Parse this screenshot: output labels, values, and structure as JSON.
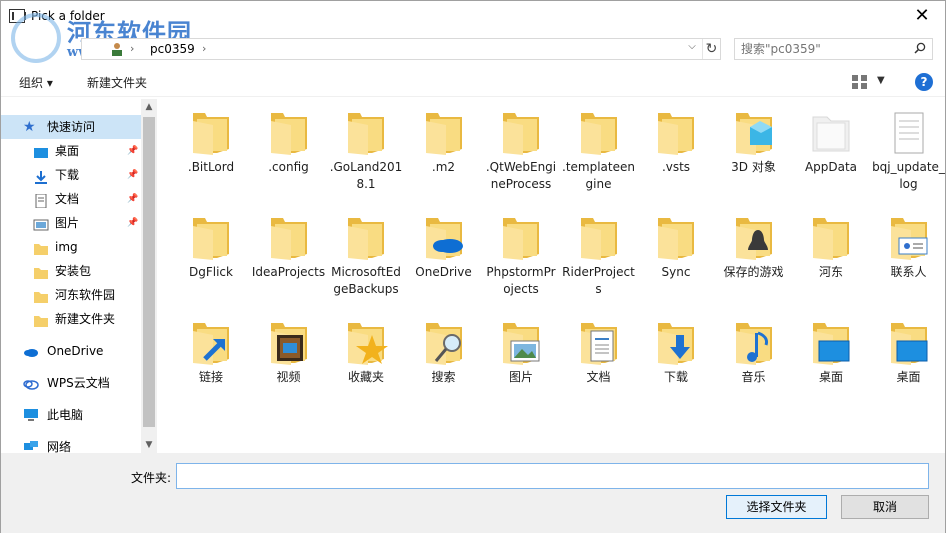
{
  "window": {
    "title": "Pick a folder",
    "close_label": "✕"
  },
  "watermark": {
    "name": "河东软件园",
    "url": "www.pc0359.cn"
  },
  "address": {
    "path": [
      "pc0359"
    ],
    "search_placeholder": "搜索\"pc0359\""
  },
  "toolbar": {
    "organize": "组织 ▾",
    "new_folder": "新建文件夹",
    "help": "?"
  },
  "sidebar": {
    "quick_access": "快速访问",
    "items": [
      {
        "label": "桌面",
        "pinned": true
      },
      {
        "label": "下载",
        "pinned": true
      },
      {
        "label": "文档",
        "pinned": true
      },
      {
        "label": "图片",
        "pinned": true
      },
      {
        "label": "img",
        "pinned": false
      },
      {
        "label": "安装包",
        "pinned": false
      },
      {
        "label": "河东软件园",
        "pinned": false
      },
      {
        "label": "新建文件夹",
        "pinned": false
      }
    ],
    "onedrive": "OneDrive",
    "wps": "WPS云文档",
    "this_pc": "此电脑",
    "network": "网络"
  },
  "folders": [
    {
      "name": ".BitLord",
      "icon": "folder-icon"
    },
    {
      "name": ".config",
      "icon": "folder-icon"
    },
    {
      "name": ".GoLand2018.1",
      "icon": "folder-icon"
    },
    {
      "name": ".m2",
      "icon": "folder-icon"
    },
    {
      "name": ".QtWebEngineProcess",
      "icon": "folder-icon"
    },
    {
      "name": ".templateengine",
      "icon": "folder-icon"
    },
    {
      "name": ".vsts",
      "icon": "folder-icon"
    },
    {
      "name": "3D 对象",
      "icon": "3d-objects-icon"
    },
    {
      "name": "AppData",
      "icon": "appdata-icon"
    },
    {
      "name": "bqj_update_log",
      "icon": "document-folder-icon"
    },
    {
      "name": "DgFlick",
      "icon": "folder-icon"
    },
    {
      "name": "IdeaProjects",
      "icon": "folder-icon"
    },
    {
      "name": "MicrosoftEdgeBackups",
      "icon": "folder-icon"
    },
    {
      "name": "OneDrive",
      "icon": "onedrive-icon"
    },
    {
      "name": "PhpstormProjects",
      "icon": "folder-icon"
    },
    {
      "name": "RiderProjects",
      "icon": "folder-icon"
    },
    {
      "name": "Sync",
      "icon": "folder-icon"
    },
    {
      "name": "保存的游戏",
      "icon": "saved-games-icon"
    },
    {
      "name": "河东",
      "icon": "folder-icon"
    },
    {
      "name": "联系人",
      "icon": "contacts-icon"
    },
    {
      "name": "链接",
      "icon": "links-icon"
    },
    {
      "name": "视频",
      "icon": "videos-icon"
    },
    {
      "name": "收藏夹",
      "icon": "favorites-icon"
    },
    {
      "name": "搜索",
      "icon": "searches-icon"
    },
    {
      "name": "图片",
      "icon": "pictures-icon"
    },
    {
      "name": "文档",
      "icon": "documents-icon"
    },
    {
      "name": "下载",
      "icon": "downloads-icon"
    },
    {
      "name": "音乐",
      "icon": "music-icon"
    },
    {
      "name": "桌面",
      "icon": "desktop-icon"
    },
    {
      "name": "桌面",
      "icon": "desktop-icon"
    }
  ],
  "footer": {
    "folder_label": "文件夹:",
    "folder_value": "",
    "select_button": "选择文件夹",
    "cancel_button": "取消"
  }
}
